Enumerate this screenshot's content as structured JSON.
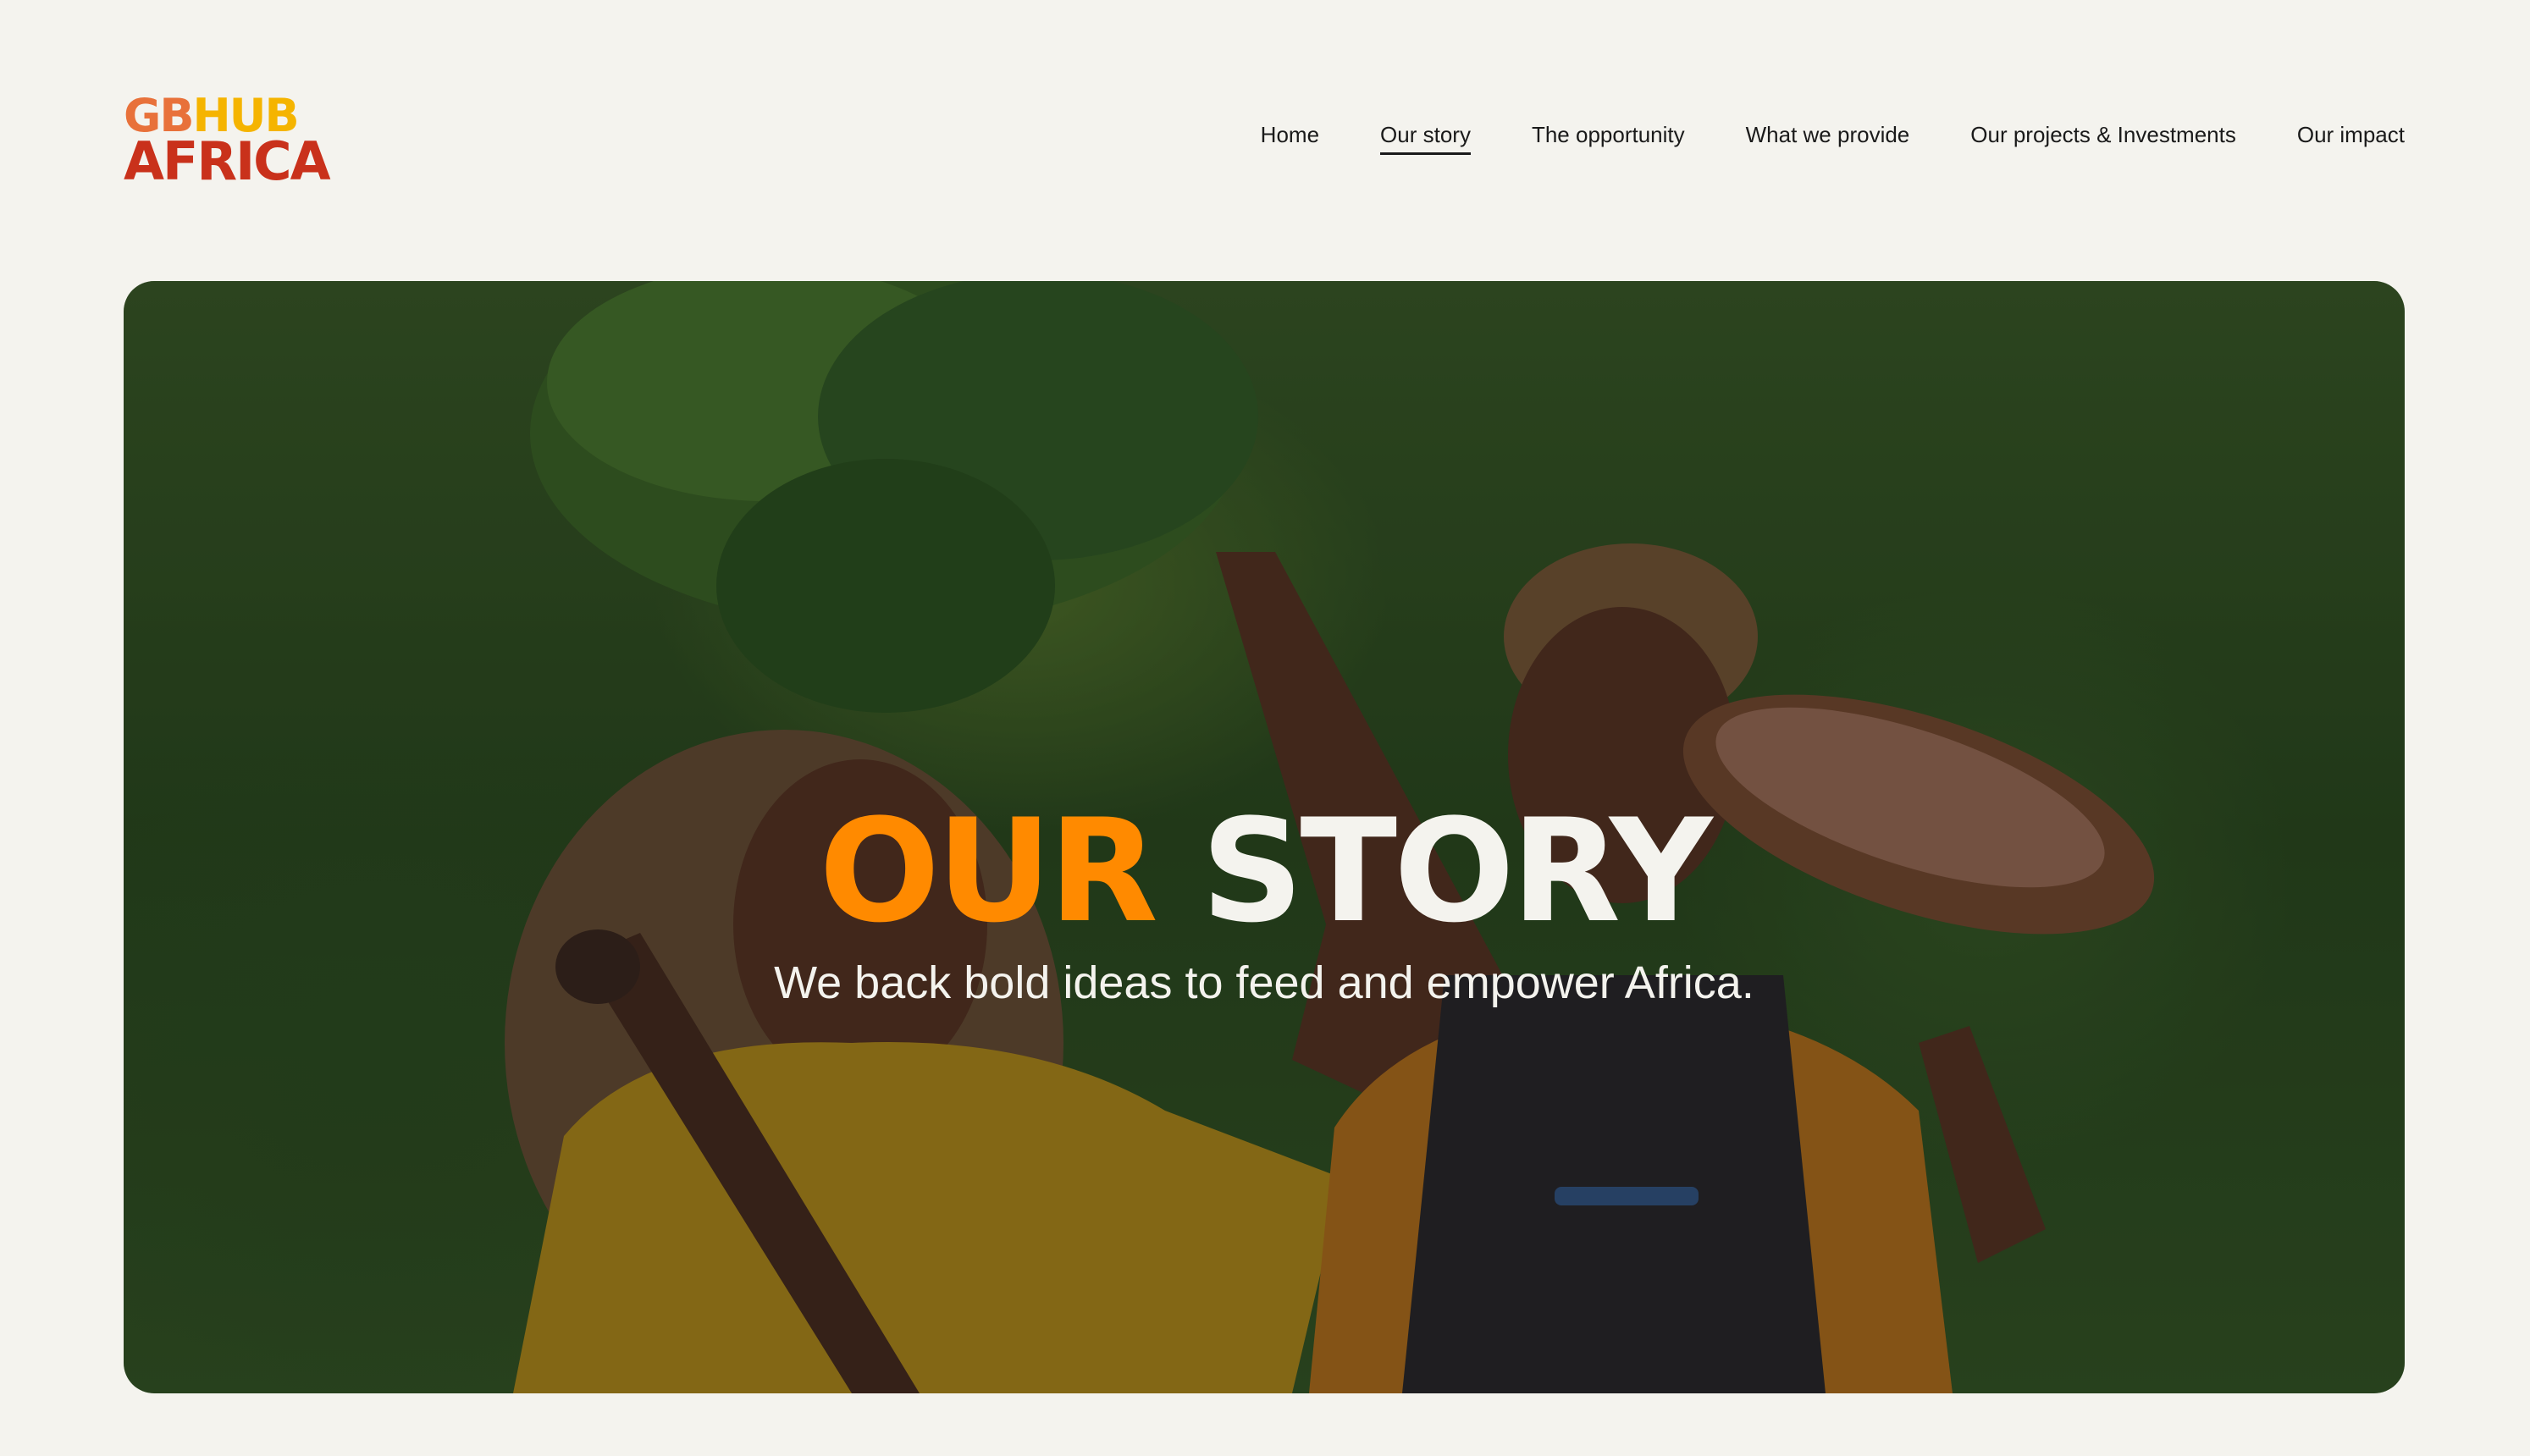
{
  "logo": {
    "part1": "GB",
    "part2": "HUB",
    "part3": "AFRICA"
  },
  "nav": {
    "items": [
      {
        "label": "Home"
      },
      {
        "label": "Our story"
      },
      {
        "label": "The opportunity"
      },
      {
        "label": "What we provide"
      },
      {
        "label": "Our projects & Investments"
      },
      {
        "label": "Our impact"
      }
    ],
    "active": "Our story"
  },
  "hero": {
    "title_part1": "OUR",
    "title_part2": "STORY",
    "subtitle": "We back bold ideas to feed and empower Africa."
  },
  "colors": {
    "background": "#f4f3ee",
    "accent": "#ff8a00",
    "logo_red": "#c9311b",
    "logo_orange": "#e8713a",
    "logo_yellow": "#f5b400"
  }
}
